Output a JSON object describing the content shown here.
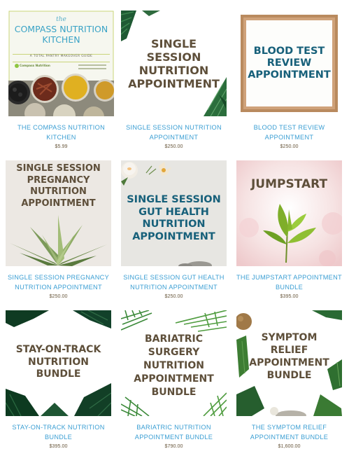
{
  "products": [
    {
      "name": "THE COMPASS NUTRITION KITCHEN",
      "price": "$5.99",
      "book": {
        "the": "the",
        "title": "COMPASS NUTRITION\nKITCHEN",
        "subtitle": "A TOTAL PANTRY MAKEOVER GUIDE",
        "brand": "Compass Nutrition"
      }
    },
    {
      "name": "SINGLE SESSION NUTRITION APPOINTMENT",
      "price": "$250.00",
      "headline": "SINGLE\nSESSION\nNUTRITION\nAPPOINTMENT"
    },
    {
      "name": "BLOOD TEST REVIEW APPOINTMENT",
      "price": "$250.00",
      "headline": "BLOOD TEST\nREVIEW\nAPPOINTMENT"
    },
    {
      "name": "SINGLE SESSION PREGNANCY NUTRITION APPOINTMENT",
      "price": "$250.00",
      "headline": "SINGLE SESSION\nPREGNANCY\nNUTRITION\nAPPOINTMENT"
    },
    {
      "name": "SINGLE SESSION GUT HEALTH NUTRITION APPOINTMENT",
      "price": "$250.00",
      "headline": "SINGLE SESSION\nGUT HEALTH\nNUTRITION\nAPPOINTMENT"
    },
    {
      "name": "THE JUMPSTART APPOINTMENT BUNDLE",
      "price": "$395.00",
      "headline": "JUMPSTART"
    },
    {
      "name": "STAY-ON-TRACK NUTRITION BUNDLE",
      "price": "$395.00",
      "headline": "STAY-ON-TRACK\nNUTRITION\nBUNDLE"
    },
    {
      "name": "BARIATRIC NUTRITION APPOINTMENT BUNDLE",
      "price": "$790.00",
      "headline": "BARIATRIC\nSURGERY\nNUTRITION\nAPPOINTMENT\nBUNDLE"
    },
    {
      "name": "THE SYMPTOM RELIEF APPOINTMENT BUNDLE",
      "price": "$1,600.00",
      "headline": "SYMPTOM\nRELIEF\nAPPOINTMENT\nBUNDLE"
    }
  ],
  "colors": {
    "link": "#3a9ed3",
    "price": "#6b5a3f",
    "headline_brown": "#5e4f3a",
    "headline_teal": "#17607a"
  }
}
